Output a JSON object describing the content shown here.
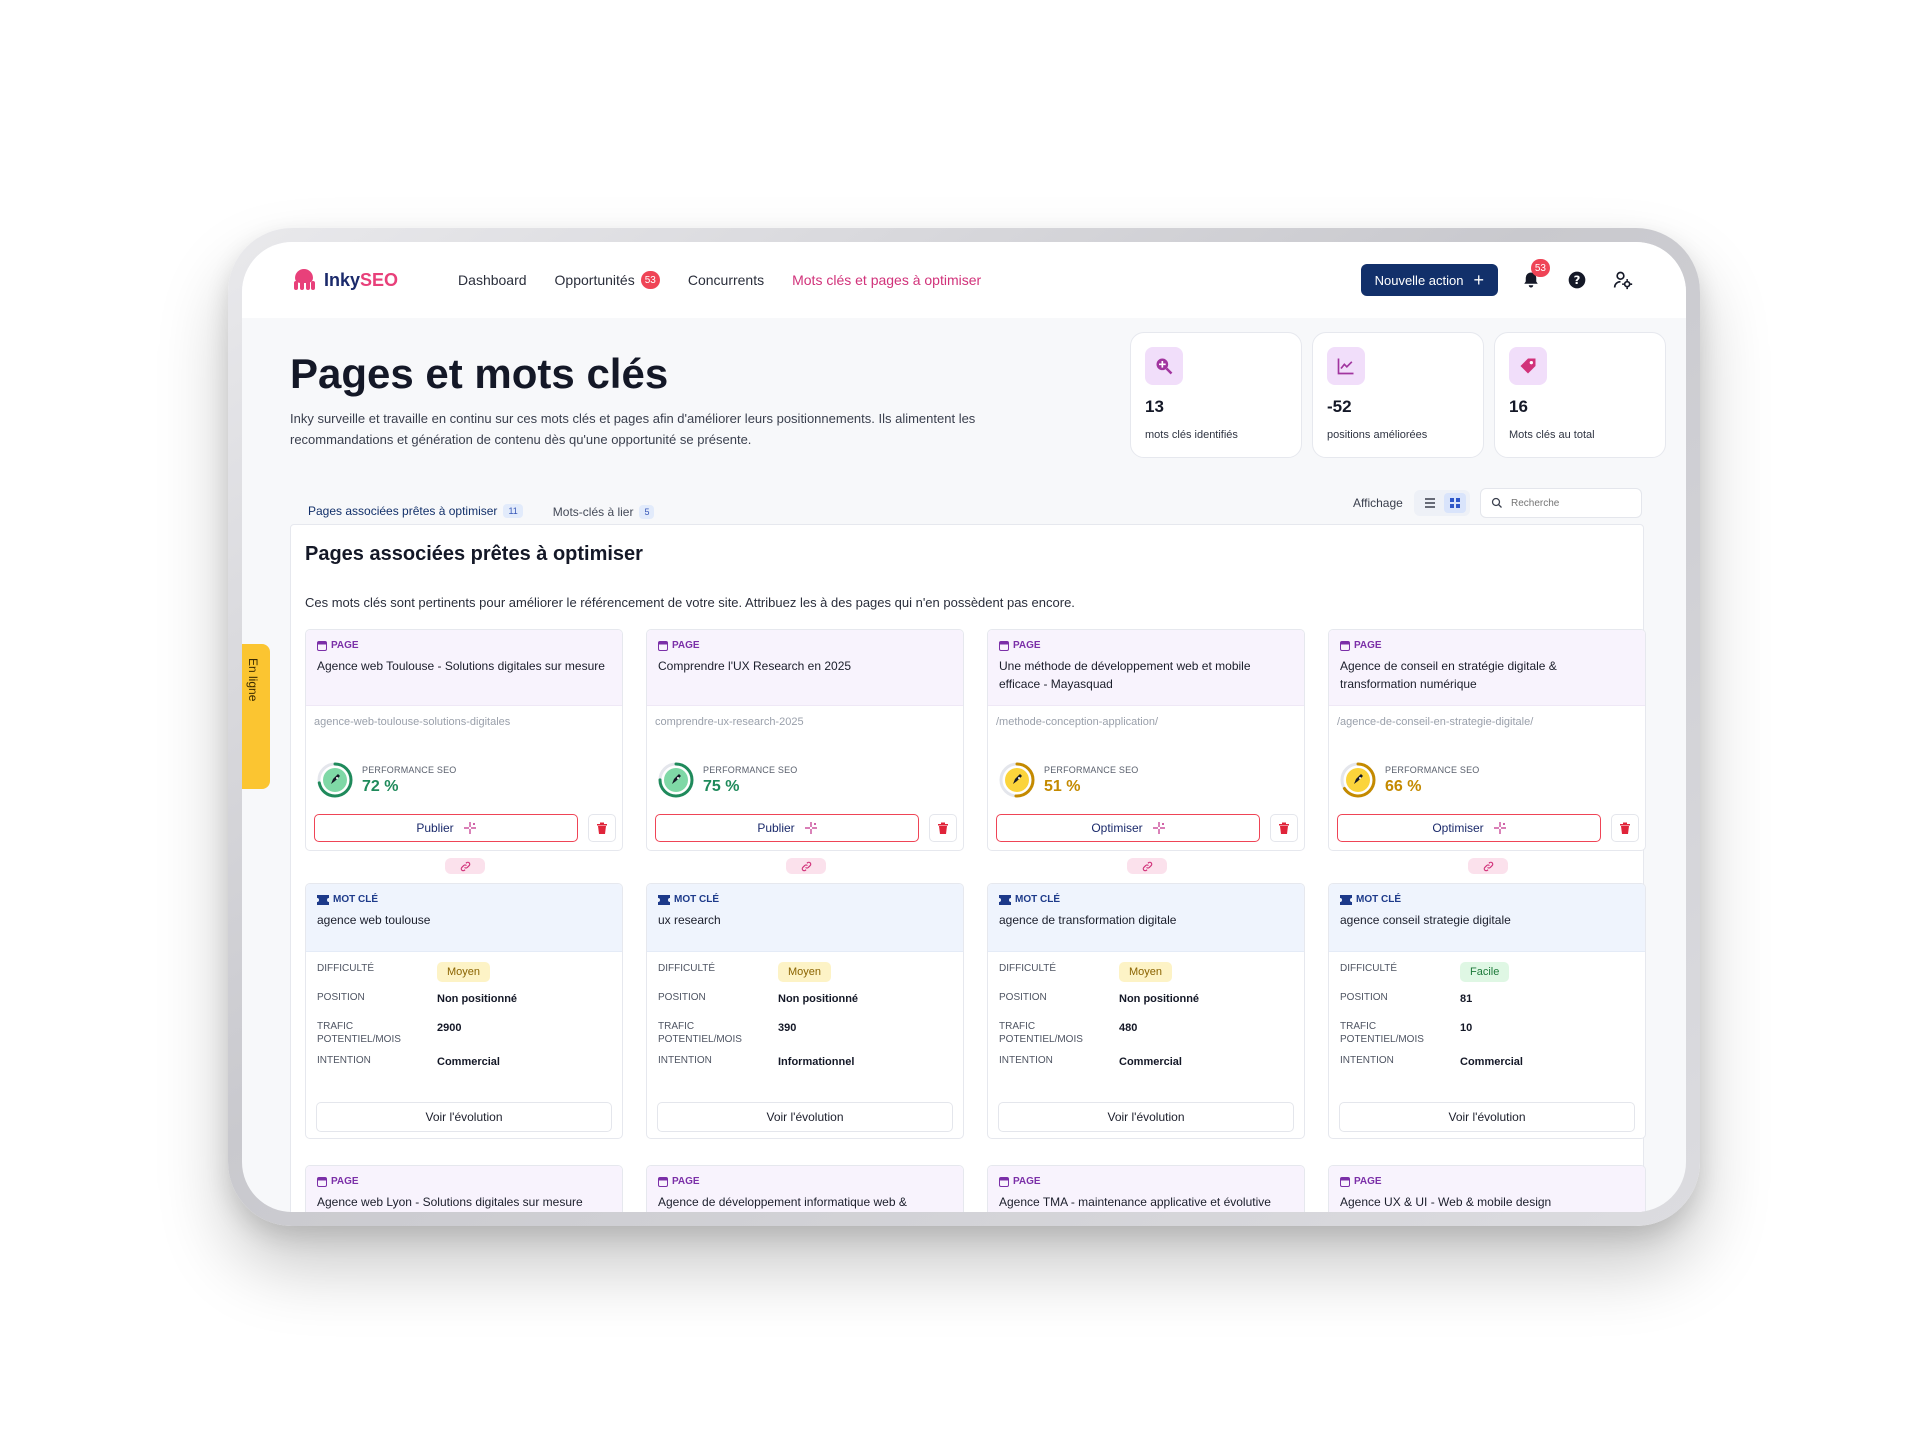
{
  "nav": {
    "logo_prefix": "Inky",
    "logo_suffix": "SEO",
    "links": [
      {
        "label": "Dashboard"
      },
      {
        "label": "Opportunités",
        "badge": "53"
      },
      {
        "label": "Concurrents"
      },
      {
        "label": "Mots clés et pages à optimiser"
      }
    ],
    "new_action": "Nouvelle action",
    "notifications_count": "53"
  },
  "header": {
    "title": "Pages et mots clés",
    "description": "Inky surveille et travaille en continu sur ces mots clés et pages afin d'améliorer leurs positionnements. Ils alimentent les recommandations et génération de contenu dès qu'une opportunité se présente."
  },
  "stats": [
    {
      "value": "13",
      "label": "mots clés identifiés",
      "icon": "search-plus-icon"
    },
    {
      "value": "-52",
      "label": "positions améliorées",
      "icon": "chart-line-icon"
    },
    {
      "value": "16",
      "label": "Mots clés au total",
      "icon": "tag-icon"
    }
  ],
  "tabs": [
    {
      "label": "Pages associées prêtes à optimiser",
      "count": "11"
    },
    {
      "label": "Mots-clés à lier",
      "count": "5"
    }
  ],
  "toolbar": {
    "display_label": "Affichage",
    "search_placeholder": "Recherche"
  },
  "panel": {
    "title": "Pages associées prêtes à optimiser",
    "description": "Ces mots clés sont pertinents pour améliorer le référencement de votre site. Attribuez les à des pages qui n'en possèdent pas encore."
  },
  "labels": {
    "page": "Page",
    "keyword": "Mot clé",
    "perf": "PERFORMANCE SEO",
    "difficulty": "Difficulté",
    "position": "Position",
    "traffic": "Trafic potentiel/mois",
    "intent": "Intention",
    "evolution": "Voir l'évolution"
  },
  "colors": {
    "green": "#1f8a5b",
    "amber": "#c48a00",
    "accent": "#12306a",
    "pink": "#e8407a"
  },
  "pairs": [
    {
      "page_title": "Agence web Toulouse - Solutions digitales sur mesure",
      "slug": "agence-web-toulouse-solutions-digitales",
      "perf": "72 %",
      "perf_value": 72,
      "perf_color": "green",
      "action": "Publier",
      "keyword": "agence web toulouse",
      "difficulty": "Moyen",
      "difficulty_level": "moyen",
      "position": "Non positionné",
      "traffic": "2900",
      "intent": "Commercial"
    },
    {
      "page_title": "Comprendre l'UX Research en 2025",
      "slug": "comprendre-ux-research-2025",
      "perf": "75 %",
      "perf_value": 75,
      "perf_color": "green",
      "action": "Publier",
      "keyword": "ux research",
      "difficulty": "Moyen",
      "difficulty_level": "moyen",
      "position": "Non positionné",
      "traffic": "390",
      "intent": "Informationnel"
    },
    {
      "page_title": "Une méthode de développement web et mobile efficace - Mayasquad",
      "slug": "/methode-conception-application/",
      "perf": "51 %",
      "perf_value": 51,
      "perf_color": "amber",
      "action": "Optimiser",
      "keyword": "agence de transformation digitale",
      "difficulty": "Moyen",
      "difficulty_level": "moyen",
      "position": "Non positionné",
      "traffic": "480",
      "intent": "Commercial"
    },
    {
      "page_title": "Agence de conseil en stratégie digitale & transformation numérique",
      "slug": "/agence-de-conseil-en-strategie-digitale/",
      "perf": "66 %",
      "perf_value": 66,
      "perf_color": "amber",
      "action": "Optimiser",
      "keyword": "agence conseil strategie digitale",
      "difficulty": "Facile",
      "difficulty_level": "facile",
      "position": "81",
      "traffic": "10",
      "intent": "Commercial"
    }
  ],
  "next_pages": [
    "Agence web Lyon - Solutions digitales sur mesure",
    "Agence de développement informatique web &",
    "Agence TMA - maintenance applicative et évolutive",
    "Agence UX & UI - Web & mobile design"
  ],
  "side_tab": "En ligne"
}
